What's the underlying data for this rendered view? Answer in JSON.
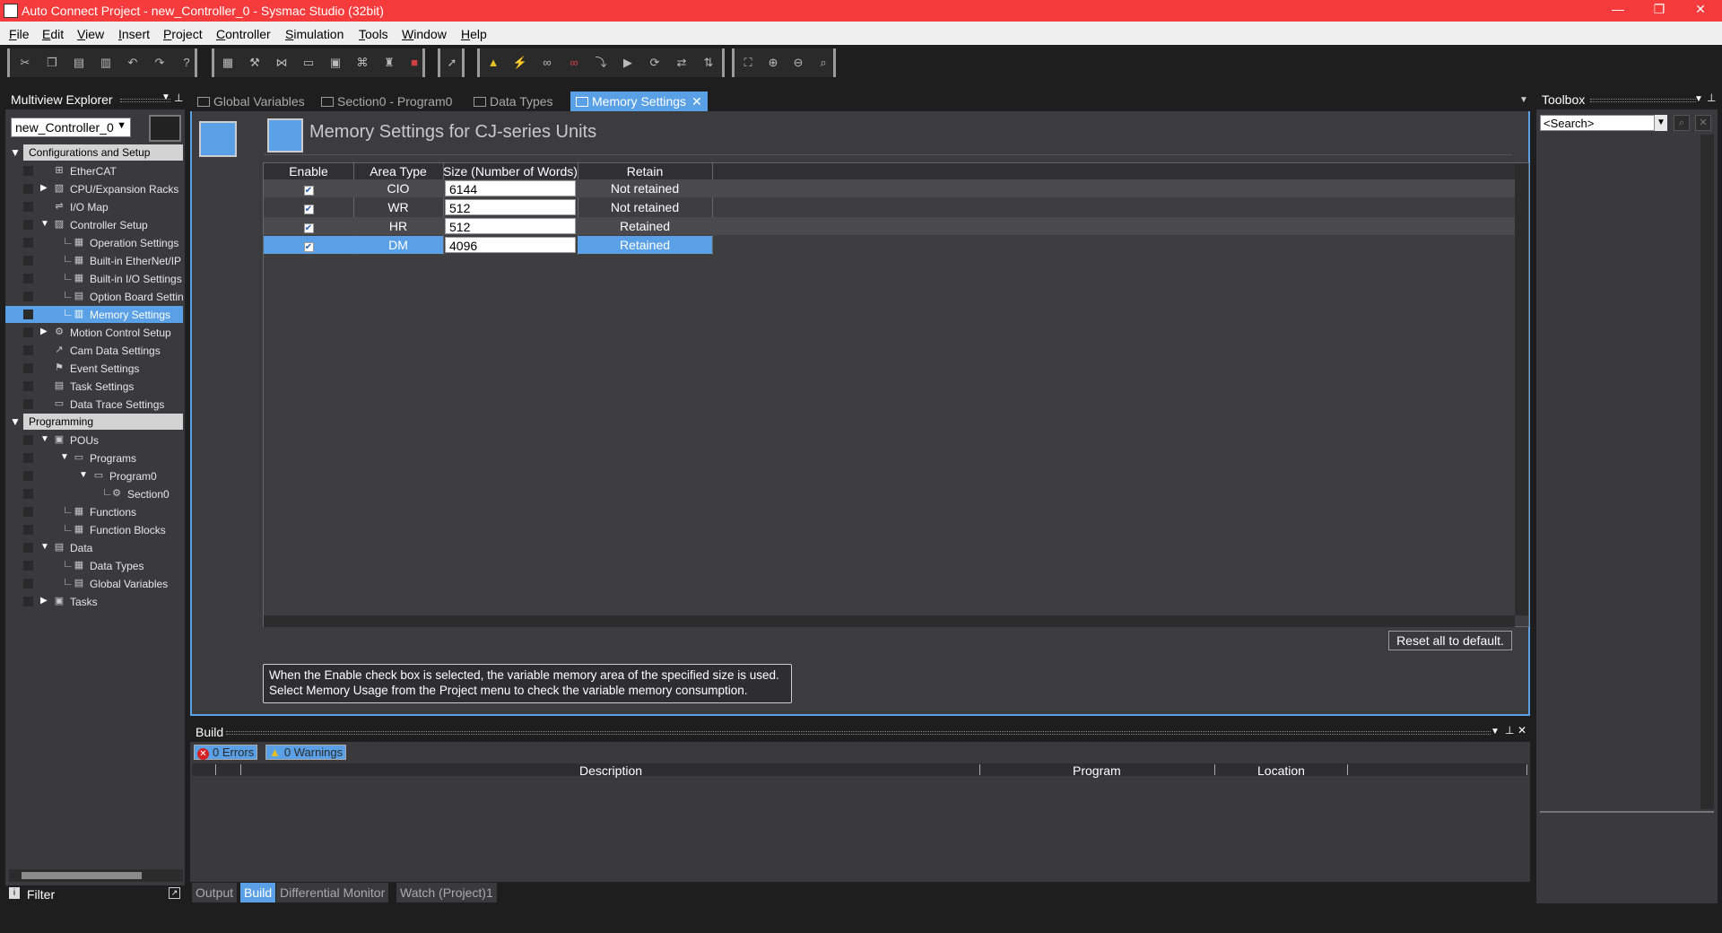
{
  "window": {
    "title": "Auto Connect Project - new_Controller_0 - Sysmac Studio (32bit)",
    "controls": [
      "—",
      "❐",
      "✕"
    ]
  },
  "menu": [
    {
      "u": "F",
      "rest": "ile"
    },
    {
      "u": "E",
      "rest": "dit"
    },
    {
      "u": "V",
      "rest": "iew"
    },
    {
      "u": "I",
      "rest": "nsert"
    },
    {
      "u": "P",
      "rest": "roject"
    },
    {
      "u": "C",
      "rest": "ontroller"
    },
    {
      "u": "S",
      "rest": "imulation"
    },
    {
      "u": "T",
      "rest": "ools"
    },
    {
      "u": "W",
      "rest": "indow"
    },
    {
      "u": "H",
      "rest": "elp"
    }
  ],
  "explorer": {
    "title": "Multiview Explorer",
    "controller": "new_Controller_0",
    "sections": [
      "Configurations and Setup",
      "Programming"
    ],
    "items": [
      "EtherCAT",
      "CPU/Expansion Racks",
      "I/O Map",
      "Controller Setup",
      "Operation Settings",
      "Built-in EtherNet/IP",
      "Built-in I/O Settings",
      "Option Board Settin",
      "Memory Settings",
      "Motion Control Setup",
      "Cam Data Settings",
      "Event Settings",
      "Task Settings",
      "Data Trace Settings",
      "POUs",
      "Programs",
      "Program0",
      "Section0",
      "Functions",
      "Function Blocks",
      "Data",
      "Data Types",
      "Global Variables",
      "Tasks"
    ],
    "filter_label": "Filter"
  },
  "doc_tabs": [
    "Global Variables",
    "Section0 - Program0",
    "Data Types",
    "Memory Settings"
  ],
  "page": {
    "title": "Memory Settings for CJ-series Units",
    "columns": [
      "Enable",
      "Area Type",
      "Size (Number of Words)",
      "Retain"
    ],
    "rows": [
      {
        "area": "CIO",
        "size": "6144",
        "retain": "Not retained"
      },
      {
        "area": "WR",
        "size": "512",
        "retain": "Not retained"
      },
      {
        "area": "HR",
        "size": "512",
        "retain": "Retained"
      },
      {
        "area": "DM",
        "size": "4096",
        "retain": "Retained"
      }
    ],
    "reset_label": "Reset all to default.",
    "info_line1": "When the Enable check box is selected, the variable memory area of the specified size is used.",
    "info_line2": "Select Memory Usage from the Project menu to check the variable memory consumption."
  },
  "build": {
    "title": "Build",
    "errors": "0  Errors",
    "warnings": "0  Warnings",
    "columns": [
      "Description",
      "Program",
      "Location"
    ]
  },
  "bottom_tabs": [
    "Output",
    "Build",
    "Differential Monitor",
    "Watch (Project)1"
  ],
  "toolbox": {
    "title": "Toolbox",
    "search_value": "<Search>"
  },
  "colors": {
    "accent": "#5aa0e6",
    "titlebar": "#f53b3b",
    "panel": "#3a3a3c"
  }
}
